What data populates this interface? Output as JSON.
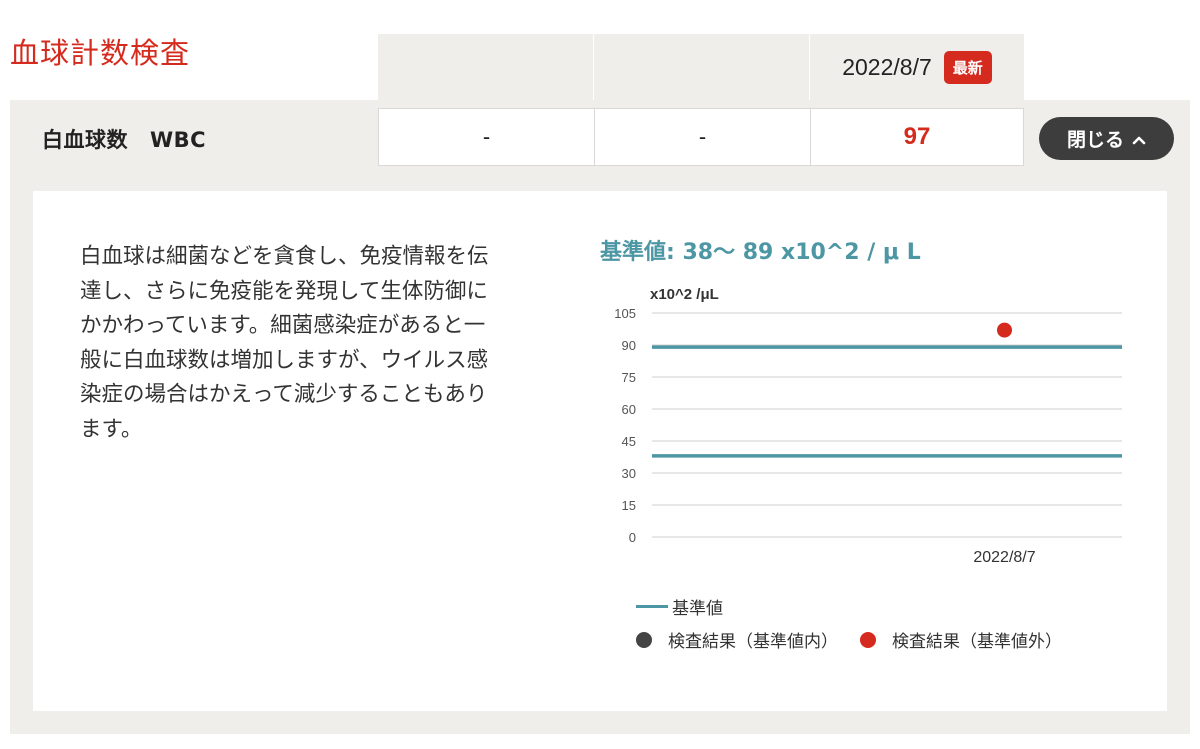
{
  "section_title": "血球計数検査",
  "header": {
    "date": "2022/8/7",
    "latest_badge": "最新"
  },
  "row": {
    "label_ja": "白血球数",
    "label_en": "WBC",
    "values": [
      "-",
      "-",
      "97"
    ]
  },
  "close_button": {
    "label": "閉じる",
    "icon": "chevron-up-icon"
  },
  "description": [
    "白血球は細菌などを貪食し、免疫情報を伝",
    "達し、さらに免疫能を発現して生体防御に",
    "かかわっています。細菌感染症があると一",
    "般に白血球数は増加しますが、ウイルス感",
    "染症の場合はかえって減少することもあり",
    "ます。"
  ],
  "reference": {
    "label": "基準値: 38〜 89 x10^2 / μ L"
  },
  "chart_data": {
    "type": "line",
    "ylabel": "x10^2 /μL",
    "ylim": [
      0,
      105
    ],
    "yticks": [
      0,
      15,
      30,
      45,
      60,
      75,
      90,
      105
    ],
    "x_categories": [
      "2022/8/7"
    ],
    "reference_range": [
      38,
      89
    ],
    "points": [
      {
        "x": "2022/8/7",
        "y": 97,
        "status": "out_of_range"
      }
    ],
    "legend": {
      "reference": "基準値",
      "in_range": "検査結果（基準値内）",
      "out_range": "検査結果（基準値外）"
    },
    "colors": {
      "reference": "#4d97a5",
      "in_range": "#444444",
      "out_range": "#d52b1e"
    },
    "grid": true
  }
}
